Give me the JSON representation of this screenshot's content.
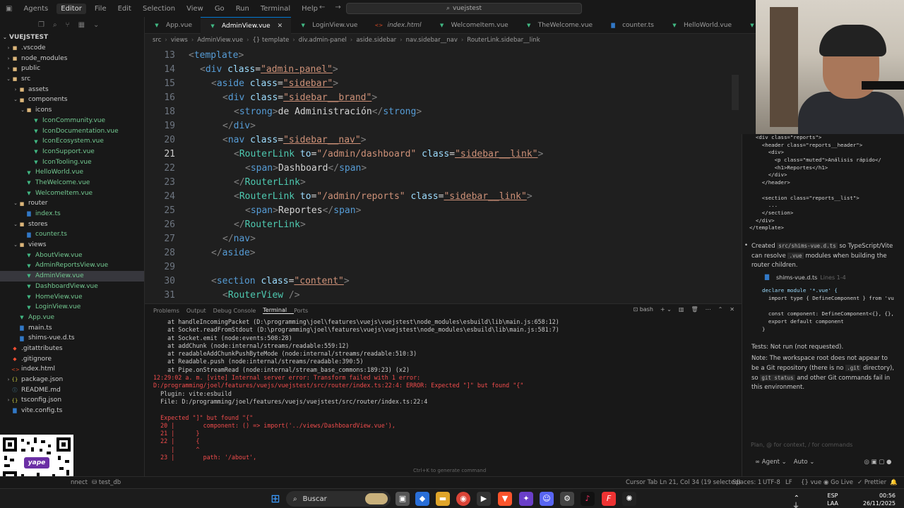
{
  "titlebar": {
    "agents": "Agents",
    "editor": "Editor",
    "menus": [
      "File",
      "Edit",
      "Selection",
      "View",
      "Go",
      "Run",
      "Terminal",
      "Help"
    ],
    "search": "vuejstest"
  },
  "explorer": {
    "title": "VUEJSTEST",
    "items": [
      {
        "label": ".vscode",
        "type": "folder",
        "depth": 1,
        "expanded": false
      },
      {
        "label": "node_modules",
        "type": "folder",
        "depth": 1,
        "expanded": false
      },
      {
        "label": "public",
        "type": "folder",
        "depth": 1,
        "expanded": false
      },
      {
        "label": "src",
        "type": "folder",
        "depth": 1,
        "expanded": true
      },
      {
        "label": "assets",
        "type": "folder",
        "depth": 2,
        "expanded": false
      },
      {
        "label": "components",
        "type": "folder",
        "depth": 2,
        "expanded": true
      },
      {
        "label": "icons",
        "type": "folder",
        "depth": 3,
        "expanded": true
      },
      {
        "label": "IconCommunity.vue",
        "type": "vue",
        "depth": 4
      },
      {
        "label": "IconDocumentation.vue",
        "type": "vue",
        "depth": 4
      },
      {
        "label": "IconEcosystem.vue",
        "type": "vue",
        "depth": 4
      },
      {
        "label": "IconSupport.vue",
        "type": "vue",
        "depth": 4
      },
      {
        "label": "IconTooling.vue",
        "type": "vue",
        "depth": 4
      },
      {
        "label": "HelloWorld.vue",
        "type": "vue",
        "depth": 3
      },
      {
        "label": "TheWelcome.vue",
        "type": "vue",
        "depth": 3
      },
      {
        "label": "WelcomeItem.vue",
        "type": "vue",
        "depth": 3
      },
      {
        "label": "router",
        "type": "folder",
        "depth": 2,
        "expanded": true
      },
      {
        "label": "index.ts",
        "type": "ts",
        "depth": 3
      },
      {
        "label": "stores",
        "type": "folder",
        "depth": 2,
        "expanded": true
      },
      {
        "label": "counter.ts",
        "type": "ts",
        "depth": 3
      },
      {
        "label": "views",
        "type": "folder",
        "depth": 2,
        "expanded": true
      },
      {
        "label": "AboutView.vue",
        "type": "vue",
        "depth": 3
      },
      {
        "label": "AdminReportsView.vue",
        "type": "vue",
        "depth": 3
      },
      {
        "label": "AdminView.vue",
        "type": "vue",
        "depth": 3,
        "selected": true
      },
      {
        "label": "DashboardView.vue",
        "type": "vue",
        "depth": 3
      },
      {
        "label": "HomeView.vue",
        "type": "vue",
        "depth": 3
      },
      {
        "label": "LoginView.vue",
        "type": "vue",
        "depth": 3
      },
      {
        "label": "App.vue",
        "type": "vue",
        "depth": 2
      },
      {
        "label": "main.ts",
        "type": "ts",
        "depth": 2
      },
      {
        "label": "shims-vue.d.ts",
        "type": "ts",
        "depth": 2
      },
      {
        "label": ".gitattributes",
        "type": "git",
        "depth": 1
      },
      {
        "label": ".gitignore",
        "type": "git",
        "depth": 1
      },
      {
        "label": "index.html",
        "type": "html",
        "depth": 1
      },
      {
        "label": "package.json",
        "type": "json",
        "depth": 1,
        "expanded": false
      },
      {
        "label": "README.md",
        "type": "md",
        "depth": 1
      },
      {
        "label": "tsconfig.json",
        "type": "json",
        "depth": 1,
        "expanded": false
      },
      {
        "label": "vite.config.ts",
        "type": "ts",
        "depth": 1
      }
    ]
  },
  "qr": {
    "label": "yape"
  },
  "tabs": [
    {
      "label": "App.vue",
      "type": "vue"
    },
    {
      "label": "AdminView.vue",
      "type": "vue",
      "active": true
    },
    {
      "label": "LoginView.vue",
      "type": "vue"
    },
    {
      "label": "index.html",
      "type": "html",
      "italic": true
    },
    {
      "label": "WelcomeItem.vue",
      "type": "vue"
    },
    {
      "label": "TheWelcome.vue",
      "type": "vue"
    },
    {
      "label": "counter.ts",
      "type": "ts"
    },
    {
      "label": "HelloWorld.vue",
      "type": "vue"
    },
    {
      "label": "HomeV",
      "type": "vue"
    }
  ],
  "breadcrumb": [
    "src",
    "views",
    "AdminView.vue",
    "{} template",
    "div.admin-panel",
    "aside.sidebar",
    "nav.sidebar__nav",
    "RouterLink.sidebar__link"
  ],
  "editor": {
    "lines": [
      {
        "n": "13",
        "indent": 0,
        "tokens": [
          [
            "br",
            "<"
          ],
          [
            "tag",
            "template"
          ],
          [
            "br",
            ">"
          ]
        ]
      },
      {
        "n": "14",
        "indent": 1,
        "tokens": [
          [
            "br",
            "<"
          ],
          [
            "tag",
            "div "
          ],
          [
            "attr",
            "class"
          ],
          [
            "txt",
            "="
          ],
          [
            "str",
            "\"admin-panel\""
          ],
          [
            "br",
            ">"
          ]
        ]
      },
      {
        "n": "15",
        "indent": 2,
        "tokens": [
          [
            "br",
            "<"
          ],
          [
            "tag",
            "aside "
          ],
          [
            "attr",
            "class"
          ],
          [
            "txt",
            "="
          ],
          [
            "str",
            "\"sidebar\""
          ],
          [
            "br",
            ">"
          ]
        ]
      },
      {
        "n": "16",
        "indent": 3,
        "tokens": [
          [
            "br",
            "<"
          ],
          [
            "tag",
            "div "
          ],
          [
            "attr",
            "class"
          ],
          [
            "txt",
            "="
          ],
          [
            "str",
            "\"sidebar__brand\""
          ],
          [
            "br",
            ">"
          ]
        ]
      },
      {
        "n": "18",
        "indent": 4,
        "tokens": [
          [
            "br",
            "<"
          ],
          [
            "tag",
            "strong"
          ],
          [
            "br",
            ">"
          ],
          [
            "txt",
            "de Administración"
          ],
          [
            "br",
            "</"
          ],
          [
            "tag",
            "strong"
          ],
          [
            "br",
            ">"
          ]
        ]
      },
      {
        "n": "19",
        "indent": 3,
        "tokens": [
          [
            "br",
            "</"
          ],
          [
            "tag",
            "div"
          ],
          [
            "br",
            ">"
          ]
        ]
      },
      {
        "n": "20",
        "indent": 3,
        "tokens": [
          [
            "br",
            "<"
          ],
          [
            "tag",
            "nav "
          ],
          [
            "attr",
            "class"
          ],
          [
            "txt",
            "="
          ],
          [
            "str",
            "\"sidebar__nav\""
          ],
          [
            "br",
            ">"
          ]
        ]
      },
      {
        "n": "21",
        "indent": 4,
        "current": true,
        "tokens": [
          [
            "br",
            "<"
          ],
          [
            "comp",
            "RouterLink "
          ],
          [
            "attr",
            "to"
          ],
          [
            "txt",
            "="
          ],
          [
            "str",
            "\"/admin/dashboard\" "
          ],
          [
            "attr",
            "class"
          ],
          [
            "txt",
            "="
          ],
          [
            "str",
            "\"sidebar__link\""
          ],
          [
            "br",
            ">"
          ]
        ]
      },
      {
        "n": "22",
        "indent": 5,
        "tokens": [
          [
            "br",
            "<"
          ],
          [
            "tag",
            "span"
          ],
          [
            "br",
            ">"
          ],
          [
            "txt",
            "Dashboard"
          ],
          [
            "br",
            "</"
          ],
          [
            "tag",
            "span"
          ],
          [
            "br",
            ">"
          ]
        ]
      },
      {
        "n": "23",
        "indent": 4,
        "tokens": [
          [
            "br",
            "</"
          ],
          [
            "comp",
            "RouterLink"
          ],
          [
            "br",
            ">"
          ]
        ]
      },
      {
        "n": "24",
        "indent": 4,
        "tokens": [
          [
            "br",
            "<"
          ],
          [
            "comp",
            "RouterLink "
          ],
          [
            "attr",
            "to"
          ],
          [
            "txt",
            "="
          ],
          [
            "str",
            "\"/admin/reports\" "
          ],
          [
            "attr",
            "class"
          ],
          [
            "txt",
            "="
          ],
          [
            "str",
            "\"sidebar__link\""
          ],
          [
            "br",
            ">"
          ]
        ]
      },
      {
        "n": "25",
        "indent": 5,
        "tokens": [
          [
            "br",
            "<"
          ],
          [
            "tag",
            "span"
          ],
          [
            "br",
            ">"
          ],
          [
            "txt",
            "Reportes"
          ],
          [
            "br",
            "</"
          ],
          [
            "tag",
            "span"
          ],
          [
            "br",
            ">"
          ]
        ]
      },
      {
        "n": "26",
        "indent": 4,
        "tokens": [
          [
            "br",
            "</"
          ],
          [
            "comp",
            "RouterLink"
          ],
          [
            "br",
            ">"
          ]
        ]
      },
      {
        "n": "27",
        "indent": 3,
        "tokens": [
          [
            "br",
            "</"
          ],
          [
            "tag",
            "nav"
          ],
          [
            "br",
            ">"
          ]
        ]
      },
      {
        "n": "28",
        "indent": 2,
        "tokens": [
          [
            "br",
            "</"
          ],
          [
            "tag",
            "aside"
          ],
          [
            "br",
            ">"
          ]
        ]
      },
      {
        "n": "29",
        "indent": 0,
        "tokens": []
      },
      {
        "n": "30",
        "indent": 2,
        "tokens": [
          [
            "br",
            "<"
          ],
          [
            "tag",
            "section "
          ],
          [
            "attr",
            "class"
          ],
          [
            "txt",
            "="
          ],
          [
            "str",
            "\"content\""
          ],
          [
            "br",
            ">"
          ]
        ]
      },
      {
        "n": "31",
        "indent": 3,
        "tokens": [
          [
            "br",
            "<"
          ],
          [
            "comp",
            "RouterView "
          ],
          [
            "br",
            "/>"
          ]
        ]
      }
    ]
  },
  "panel": {
    "tabs": [
      "Problems",
      "Output",
      "Debug Console",
      "Terminal",
      "Ports"
    ],
    "active_tab": "Terminal",
    "shell": "bash",
    "lines": [
      {
        "cls": "",
        "text": "    at handleIncomingPacket (D:\\programming\\joel\\features\\vuejs\\vuejstest\\node_modules\\esbuild\\lib\\main.js:658:12)"
      },
      {
        "cls": "",
        "text": "    at Socket.readFromStdout (D:\\programming\\joel\\features\\vuejs\\vuejstest\\node_modules\\esbuild\\lib\\main.js:581:7)"
      },
      {
        "cls": "",
        "text": "    at Socket.emit (node:events:508:28)"
      },
      {
        "cls": "",
        "text": "    at addChunk (node:internal/streams/readable:559:12)"
      },
      {
        "cls": "",
        "text": "    at readableAddChunkPushByteMode (node:internal/streams/readable:510:3)"
      },
      {
        "cls": "",
        "text": "    at Readable.push (node:internal/streams/readable:390:5)"
      },
      {
        "cls": "",
        "text": "    at Pipe.onStreamRead (node:internal/stream_base_commons:189:23) (x2)"
      },
      {
        "cls": "err",
        "text": "12:29:02 a. m. [vite] Internal server error: Transform failed with 1 error:"
      },
      {
        "cls": "err",
        "text": "D:/programming/joel/features/vuejs/vuejstest/src/router/index.ts:22:4: ERROR: Expected \"]\" but found \"{\""
      },
      {
        "cls": "",
        "text": "  Plugin: vite:esbuild"
      },
      {
        "cls": "",
        "text": "  File: D:/programming/joel/features/vuejs/vuejstest/src/router/index.ts:22:4"
      },
      {
        "cls": "",
        "text": " "
      },
      {
        "cls": "err",
        "text": "  Expected \"]\" but found \"{\""
      },
      {
        "cls": "err",
        "text": "  20 |        component: () => import('../views/DashboardView.vue'),"
      },
      {
        "cls": "err",
        "text": "  21 |      }"
      },
      {
        "cls": "err",
        "text": "  22 |      {"
      },
      {
        "cls": "err",
        "text": "     |      ^"
      },
      {
        "cls": "err",
        "text": "  23 |        path: '/about',"
      }
    ],
    "hint": "Ctrl+K to generate command"
  },
  "chat": {
    "code1": [
      "  <div class=\"reports\">",
      "    <header class=\"reports__header\">",
      "      <div>",
      "        <p class=\"muted\">Análisis rápido</",
      "        <h1>Reportes</h1>",
      "      </div>",
      "    </header>",
      "",
      "    <section class=\"reports__list\">",
      "      ...",
      "    </section>",
      "  </div>",
      "</template>"
    ],
    "bullet_prefix": "Created",
    "bullet_code1": "src/shims-vue.d.ts",
    "bullet_mid": "so TypeScript/Vite can resolve",
    "bullet_code2": ".vue",
    "bullet_suffix": "modules when building the router children.",
    "file_chip": "shims-vue.d.ts",
    "file_lines": "Lines 1-4",
    "code2": [
      "declare module '*.vue' {",
      "  import type { DefineComponent } from 'vu",
      "",
      "  const component: DefineComponent<{}, {},",
      "  export default component",
      "}"
    ],
    "tests": "Tests: Not run (not requested).",
    "note_a": "Note: The workspace root does not appear to be a Git repository (there is no",
    "note_code1": ".git",
    "note_b": "directory), so",
    "note_code2": "git status",
    "note_c": "and other Git commands fail in this environment.",
    "input_placeholder": "Plan, @ for context, / for commands",
    "agent_label": "Agent",
    "auto_label": "Auto"
  },
  "statusbar": {
    "connect": "nnect",
    "db": "test_db",
    "cursor_tab": "Cursor Tab",
    "position": "Ln 21, Col 34 (19 selected)",
    "spaces": "Spaces: 1",
    "encoding": "UTF-8",
    "eol": "LF",
    "lang": "vue",
    "golive": "Go Live",
    "prettier": "Prettier"
  },
  "taskbar": {
    "search": "Buscar",
    "lang1": "ESP",
    "lang2": "LAA",
    "time": "00:56",
    "date": "26/11/2025"
  }
}
